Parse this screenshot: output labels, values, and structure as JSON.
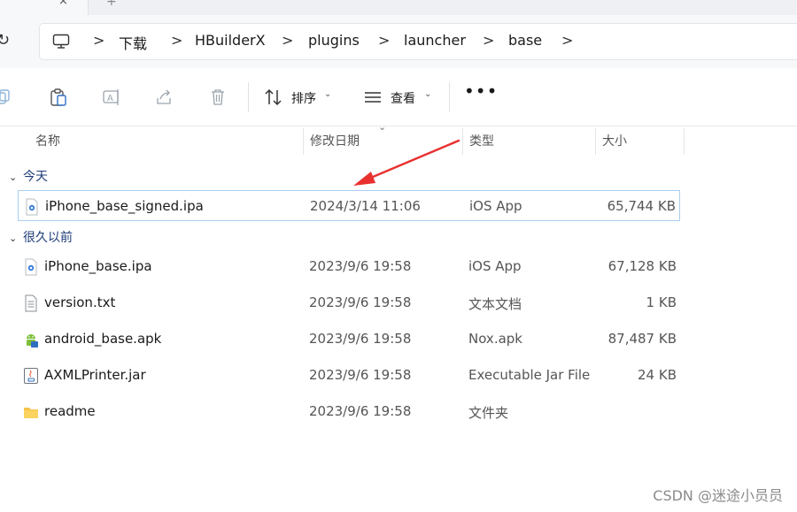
{
  "breadcrumb": {
    "items": [
      "下载",
      "HBuilderX",
      "plugins",
      "launcher",
      "base"
    ],
    "separator": ">"
  },
  "toolbar": {
    "sort_label": "排序",
    "view_label": "查看",
    "more_label": "•••"
  },
  "columns": {
    "name": "名称",
    "modified": "修改日期",
    "type": "类型",
    "size": "大小"
  },
  "groups": [
    {
      "label": "今天",
      "files": [
        {
          "name": "iPhone_base_signed.ipa",
          "modified": "2024/3/14 11:06",
          "type": "iOS App",
          "size": "65,744 KB",
          "icon": "ipa-file-icon",
          "selected": true
        }
      ]
    },
    {
      "label": "很久以前",
      "files": [
        {
          "name": "iPhone_base.ipa",
          "modified": "2023/9/6 19:58",
          "type": "iOS App",
          "size": "67,128 KB",
          "icon": "ipa-file-icon"
        },
        {
          "name": "version.txt",
          "modified": "2023/9/6 19:58",
          "type": "文本文档",
          "size": "1 KB",
          "icon": "text-file-icon"
        },
        {
          "name": "android_base.apk",
          "modified": "2023/9/6 19:58",
          "type": "Nox.apk",
          "size": "87,487 KB",
          "icon": "apk-file-icon"
        },
        {
          "name": "AXMLPrinter.jar",
          "modified": "2023/9/6 19:58",
          "type": "Executable Jar File",
          "size": "24 KB",
          "icon": "jar-file-icon"
        },
        {
          "name": "readme",
          "modified": "2023/9/6 19:58",
          "type": "文件夹",
          "size": "",
          "icon": "folder-icon"
        }
      ]
    }
  ],
  "watermark": "CSDN @迷途小员员",
  "colors": {
    "selection_border": "#a9cff0",
    "group_text": "#1f3d7a",
    "annotation_arrow": "#e8312f"
  }
}
